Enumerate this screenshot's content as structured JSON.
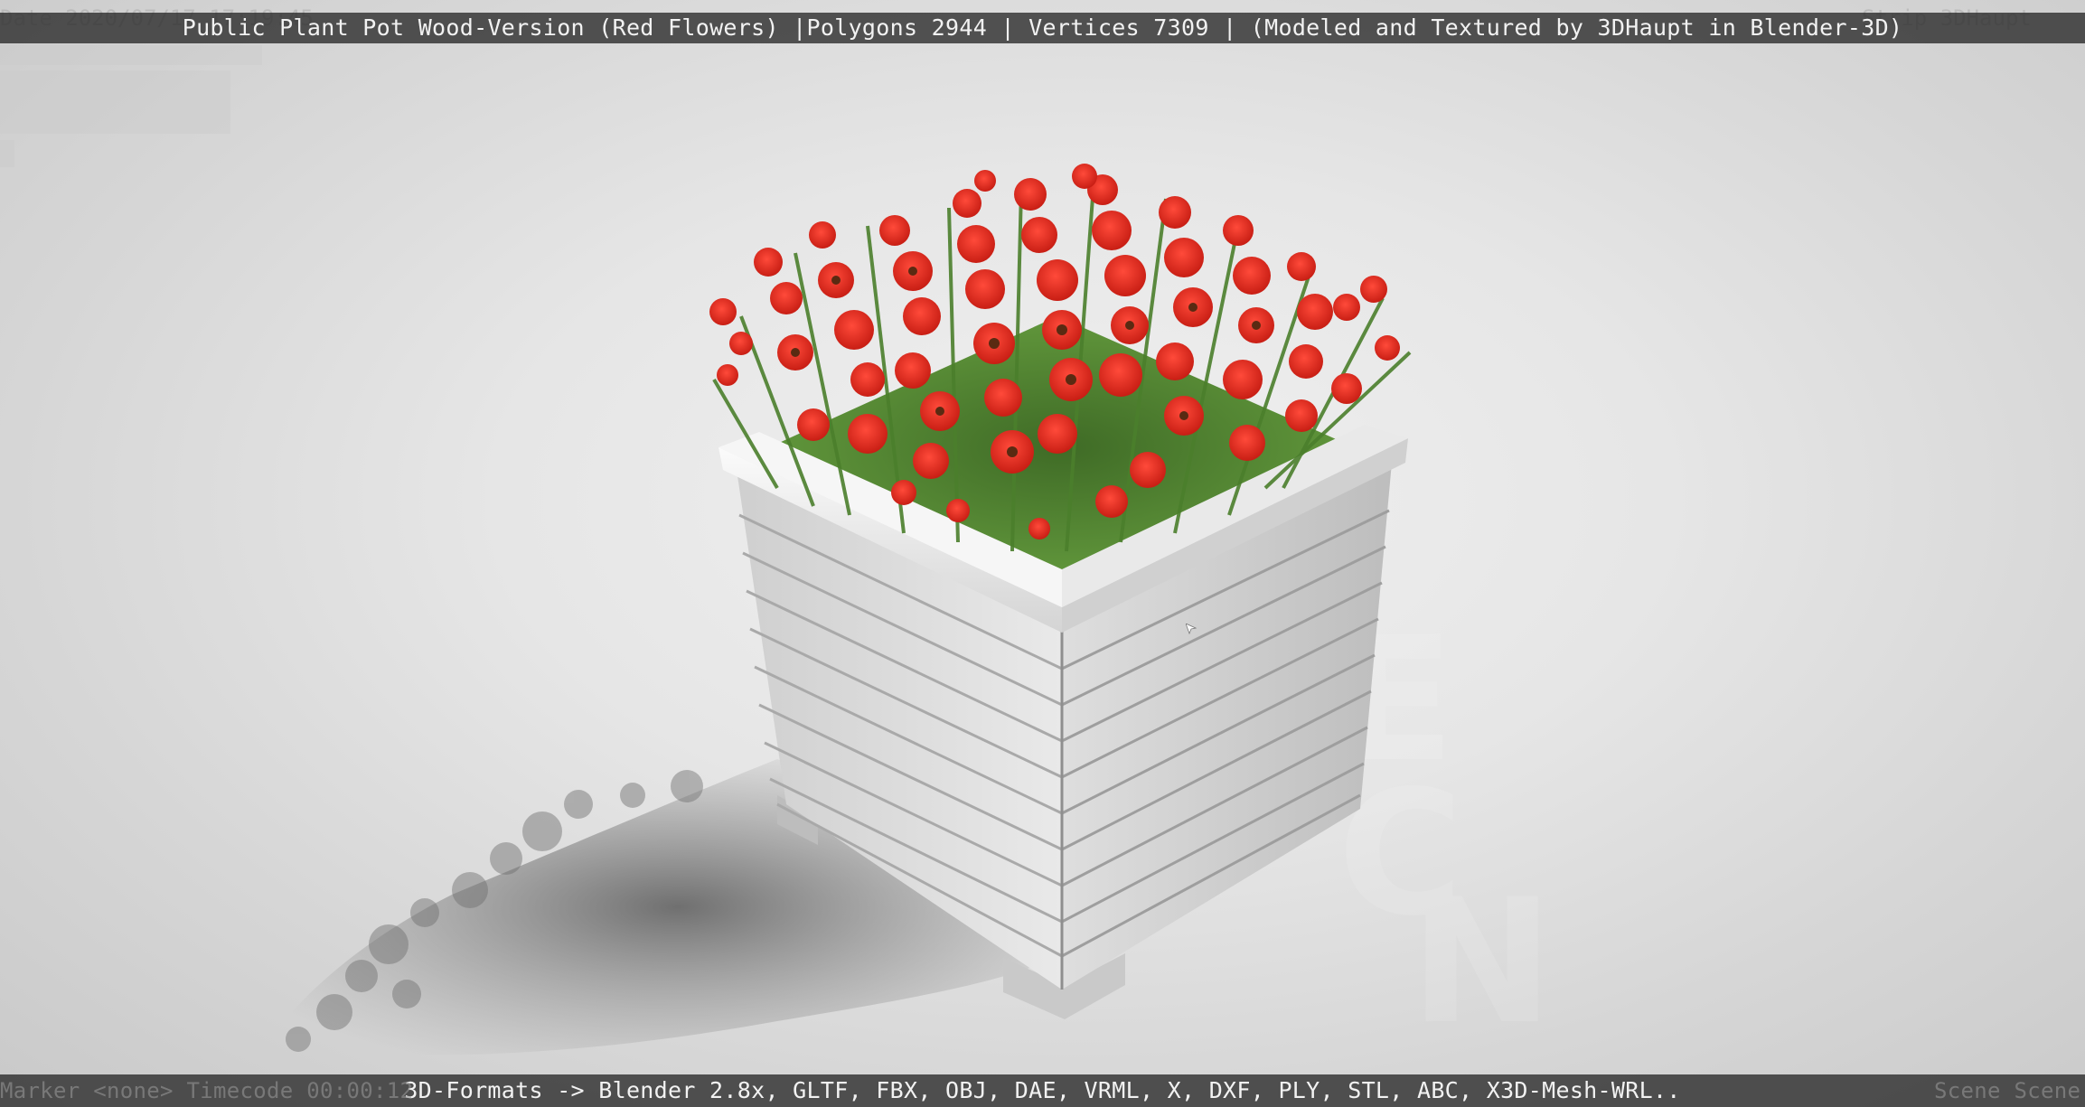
{
  "viewport": {
    "title_text": "Public Plant Pot Wood-Version (Red Flowers) |Polygons 2944 | Vertices 7309 | (Modeled and Textured by 3DHaupt in Blender-3D)",
    "formats_text": "3D-Formats -> Blender 2.8x, GLTF, FBX, OBJ, DAE, VRML, X, DXF, PLY, STL, ABC, X3D-Mesh-WRL..",
    "faint_left_top": "Date 2020/07/17 17:19:45",
    "faint_right_top": "Strip 3DHaupt",
    "faint_left_bottom": "Marker <none>   Timecode 00:00:12",
    "faint_right_bottom": "Scene Scene"
  },
  "colors": {
    "background": "#e2e2e2",
    "overlay_bar": "#2b2b2b",
    "overlay_text": "#f2f2f2",
    "pot_wood": "#d9d9d9",
    "flower_red": "#e0281f",
    "leaf_green": "#4f8a33",
    "shadow": "#777777"
  },
  "scene": {
    "subject": "wooden-plant-pot-with-red-flowers"
  }
}
